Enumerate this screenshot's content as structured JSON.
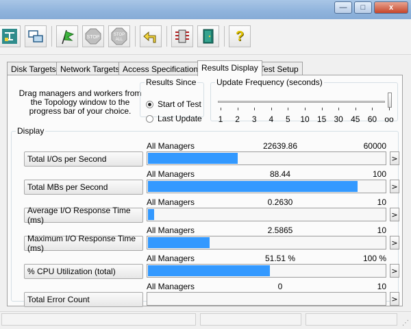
{
  "window": {
    "minimize_label": "—",
    "maximize_label": "□",
    "close_label": "x"
  },
  "toolbar": {
    "stop_label": "STOP",
    "stop_all_label": "STOP ALL",
    "help_label": "?"
  },
  "tabs": [
    {
      "label": "Disk Targets"
    },
    {
      "label": "Network Targets"
    },
    {
      "label": "Access Specifications"
    },
    {
      "label": "Results Display"
    },
    {
      "label": "Test Setup"
    }
  ],
  "hint_text": "Drag managers and workers from the Topology window to the progress bar of your choice.",
  "results_since": {
    "legend": "Results Since",
    "options": [
      "Start of Test",
      "Last Update"
    ],
    "selected": 0
  },
  "update_frequency": {
    "legend": "Update Frequency (seconds)",
    "ticks": [
      "1",
      "2",
      "3",
      "4",
      "5",
      "10",
      "15",
      "30",
      "45",
      "60",
      "oo"
    ],
    "selected_index": 10
  },
  "display": {
    "legend": "Display",
    "metrics": [
      {
        "label": "Total I/Os per Second",
        "source": "All Managers",
        "value": "22639.86",
        "max": "60000",
        "fraction": 0.3773
      },
      {
        "label": "Total MBs per Second",
        "source": "All Managers",
        "value": "88.44",
        "max": "100",
        "fraction": 0.8844
      },
      {
        "label": "Average I/O Response Time (ms)",
        "source": "All Managers",
        "value": "0.2630",
        "max": "10",
        "fraction": 0.0263
      },
      {
        "label": "Maximum I/O Response Time (ms)",
        "source": "All Managers",
        "value": "2.5865",
        "max": "10",
        "fraction": 0.2587
      },
      {
        "label": "% CPU Utilization (total)",
        "source": "All Managers",
        "value": "51.51 %",
        "max": "100 %",
        "fraction": 0.5151
      },
      {
        "label": "Total Error Count",
        "source": "All Managers",
        "value": "0",
        "max": "10",
        "fraction": 0
      }
    ]
  },
  "colors": {
    "bar_fill": "#3399ff"
  }
}
